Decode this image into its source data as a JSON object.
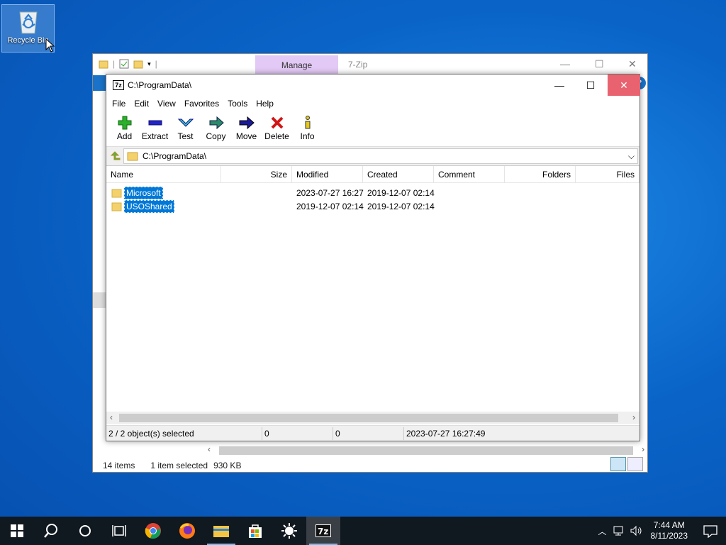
{
  "desktop": {
    "recycle_bin_label": "Recycle Bin"
  },
  "explorer": {
    "manage_tab": "Manage",
    "app_title": "7-Zip",
    "help": "?",
    "status": {
      "items": "14 items",
      "selected": "1 item selected",
      "size": "930 KB"
    }
  },
  "zip": {
    "title": "C:\\ProgramData\\",
    "icon_text": "7z",
    "menu": [
      "File",
      "Edit",
      "View",
      "Favorites",
      "Tools",
      "Help"
    ],
    "toolbar": [
      "Add",
      "Extract",
      "Test",
      "Copy",
      "Move",
      "Delete",
      "Info"
    ],
    "address": "C:\\ProgramData\\",
    "columns": [
      "Name",
      "Size",
      "Modified",
      "Created",
      "Comment",
      "Folders",
      "Files"
    ],
    "rows": [
      {
        "name": "Microsoft",
        "size": "",
        "modified": "2023-07-27 16:27",
        "created": "2019-12-07 02:14"
      },
      {
        "name": "USOShared",
        "size": "",
        "modified": "2019-12-07 02:14",
        "created": "2019-12-07 02:14"
      }
    ],
    "status": {
      "selected": "2 / 2 object(s) selected",
      "size1": "0",
      "size2": "0",
      "date": "2023-07-27 16:27:49"
    }
  },
  "taskbar": {
    "time": "7:44 AM",
    "date": "8/11/2023"
  },
  "colors": {
    "selection": "#0078d7",
    "close_hover": "#e8636f",
    "manage_tab": "#e3c9f5"
  }
}
